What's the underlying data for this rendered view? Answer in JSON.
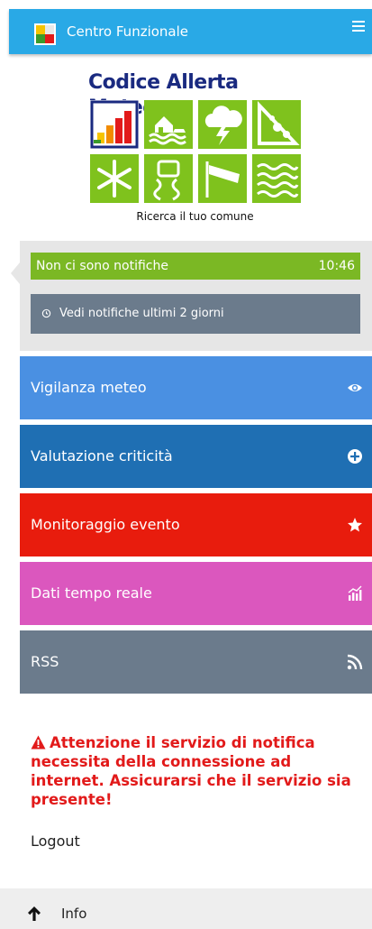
{
  "topbar": {
    "title": "Centro Funzionale",
    "logo_icon": "app-logo-icon",
    "menu_icon": "hamburger-menu-icon",
    "color": "#29a9e6"
  },
  "brand": {
    "title": "Codice Allerta Meteo",
    "title_color": "#1a2a80",
    "tile_color": "#7fc21d",
    "tiles": [
      {
        "icon": "alert-levels-icon",
        "selected": true
      },
      {
        "icon": "flood-house-icon",
        "selected": false
      },
      {
        "icon": "thunderstorm-icon",
        "selected": false
      },
      {
        "icon": "landslide-icon",
        "selected": false
      },
      {
        "icon": "snowflake-icon",
        "selected": false
      },
      {
        "icon": "ice-road-icon",
        "selected": false
      },
      {
        "icon": "windsock-icon",
        "selected": false
      },
      {
        "icon": "sea-waves-icon",
        "selected": false
      }
    ],
    "search_caption": "Ricerca il tuo comune"
  },
  "notifications": {
    "status_text": "Non ci sono notifiche",
    "time": "10:46",
    "status_color": "#7bb824",
    "history_label": "Vedi notifiche ultimi 2 giorni",
    "history_icon": "history-icon"
  },
  "menu": [
    {
      "label": "Vigilanza meteo",
      "icon": "eye-icon",
      "color": "#4a90e2"
    },
    {
      "label": "Valutazione criticità",
      "icon": "plus-circle-icon",
      "color": "#1f6fb3"
    },
    {
      "label": "Monitoraggio evento",
      "icon": "star-icon",
      "color": "#e81c0d"
    },
    {
      "label": "Dati tempo reale",
      "icon": "chart-icon",
      "color": "#db57be"
    },
    {
      "label": "RSS",
      "icon": "rss-icon",
      "color": "#6b7b8c"
    }
  ],
  "warning": {
    "icon": "warning-triangle-icon",
    "text": "Attenzione il servizio di notifica necessita della connessione ad internet. Assicurarsi che il servizio sia presente!",
    "color": "#e21a1a"
  },
  "logout": {
    "label": "Logout"
  },
  "footer": {
    "label": "Info",
    "icon": "arrow-up-icon"
  }
}
